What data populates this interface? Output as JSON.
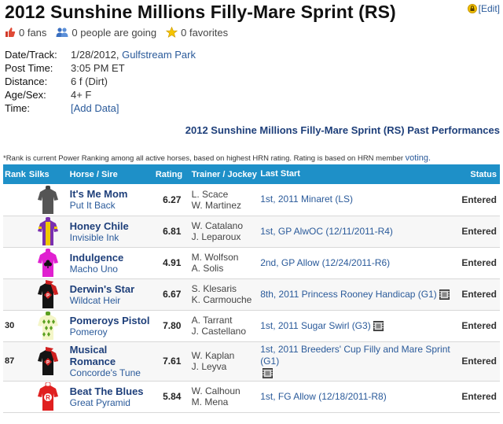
{
  "page": {
    "title": "2012 Sunshine Millions Filly-Mare Sprint (RS)",
    "edit_label": "[Edit]"
  },
  "social": {
    "fans": "0 fans",
    "going": "0 people are going",
    "favorites": "0 favorites"
  },
  "info": {
    "date_track_label": "Date/Track:",
    "date": "1/28/2012,",
    "track": "Gulfstream Park",
    "post_time_label": "Post Time:",
    "post_time": "3:05 PM ET",
    "distance_label": "Distance:",
    "distance": "6 f (Dirt)",
    "age_sex_label": "Age/Sex:",
    "age_sex": "4+ F",
    "time_label": "Time:",
    "time_value": "[Add Data]"
  },
  "pp_title": "2012 Sunshine Millions Filly-Mare Sprint (RS) Past Performances",
  "note": {
    "text": "*Rank is current Power Ranking among all active horses, based on highest HRN rating. Rating is based on HRN member",
    "link": "voting."
  },
  "table": {
    "headers": {
      "rank": "Rank",
      "silks": "Silks",
      "horse": "Horse / Sire",
      "rating": "Rating",
      "trainer": "Trainer / Jockey",
      "last_start": "Last Start",
      "status": "Status"
    },
    "rows": [
      {
        "rank": "",
        "horse": "It's Me Mom",
        "sire": "Put It Back",
        "rating": "6.27",
        "trainer": "L. Scace",
        "jockey": "W. Martinez",
        "last_start": "1st, 2011 Minaret (LS)",
        "status": "Entered",
        "silk": "gray",
        "video": false
      },
      {
        "rank": "",
        "horse": "Honey Chile",
        "sire": "Invisible Ink",
        "rating": "6.81",
        "trainer": "W. Catalano",
        "jockey": "J. Leparoux",
        "last_start": "1st, GP AlwOC (12/11/2011-R4)",
        "status": "Entered",
        "silk": "purple-gold",
        "video": false
      },
      {
        "rank": "",
        "horse": "Indulgence",
        "sire": "Macho Uno",
        "rating": "4.91",
        "trainer": "M. Wolfson",
        "jockey": "A. Solis",
        "last_start": "2nd, GP Allow (12/24/2011-R6)",
        "status": "Entered",
        "silk": "magenta",
        "video": false
      },
      {
        "rank": "",
        "horse": "Derwin's Star",
        "sire": "Wildcat Heir",
        "rating": "6.67",
        "trainer": "S. Klesaris",
        "jockey": "K. Carmouche",
        "last_start": "8th, 2011 Princess Rooney Handicap (G1)",
        "status": "Entered",
        "silk": "black-red",
        "video": true
      },
      {
        "rank": "30",
        "horse": "Pomeroys Pistol",
        "sire": "Pomeroy",
        "rating": "7.80",
        "trainer": "A. Tarrant",
        "jockey": "J. Castellano",
        "last_start": "1st, 2011 Sugar Swirl (G3)",
        "status": "Entered",
        "silk": "green-diamond",
        "video": true
      },
      {
        "rank": "87",
        "horse": "Musical Romance",
        "sire": "Concorde's Tune",
        "rating": "7.61",
        "trainer": "W. Kaplan",
        "jockey": "J. Leyva",
        "last_start": "1st, 2011 Breeders' Cup Filly and Mare Sprint (G1)",
        "status": "Entered",
        "silk": "black-red",
        "video": true
      },
      {
        "rank": "",
        "horse": "Beat The Blues",
        "sire": "Great Pyramid",
        "rating": "5.84",
        "trainer": "W. Calhoun",
        "jockey": "M. Mena",
        "last_start": "1st, FG Allow (12/18/2011-R8)",
        "status": "Entered",
        "silk": "red-white",
        "video": false
      }
    ]
  }
}
